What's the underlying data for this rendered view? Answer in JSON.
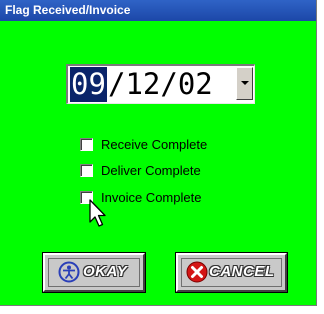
{
  "window": {
    "title": "Flag Received/Invoice"
  },
  "date": {
    "month": "09",
    "rest": "/12/02"
  },
  "checkboxes": [
    {
      "label": "Receive Complete",
      "checked": false
    },
    {
      "label": "Deliver Complete",
      "checked": false
    },
    {
      "label": "Invoice Complete",
      "checked": false
    }
  ],
  "buttons": {
    "okay": {
      "label": "OKAY",
      "icon": "person-circle-icon"
    },
    "cancel": {
      "label": "CANCEL",
      "icon": "x-circle-icon"
    }
  },
  "colors": {
    "background": "#00ff00",
    "titlebar": "#1c47a8",
    "selection": "#0a246a",
    "okay_icon": "#2a3fb8",
    "cancel_icon": "#d41515"
  }
}
